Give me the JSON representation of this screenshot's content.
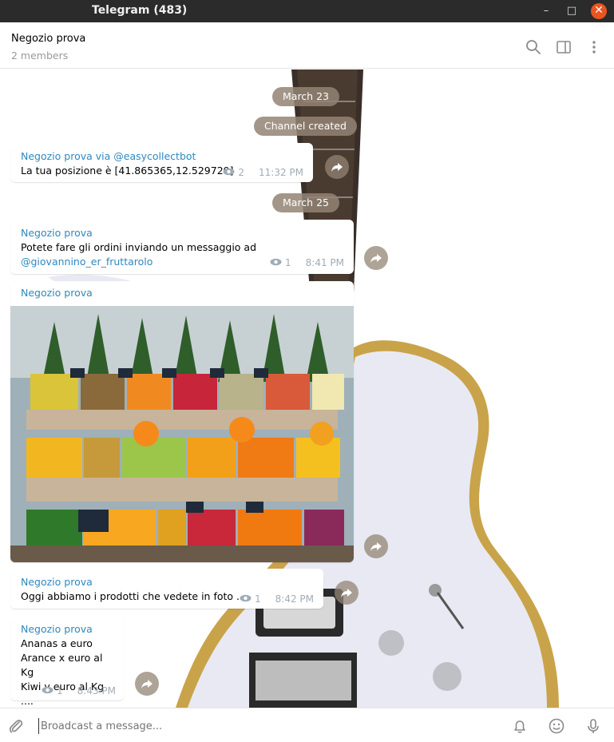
{
  "window": {
    "title": "Telegram (483)",
    "minimize": "–",
    "maximize": "□",
    "close": "✕"
  },
  "header": {
    "chat_name": "Negozio prova",
    "subtitle": "2 members"
  },
  "services": {
    "date1": "March 23",
    "created": "Channel created",
    "date2": "March 25"
  },
  "messages": [
    {
      "author": "Negozio prova via @easycollectbot",
      "text": "La tua posizione è [41.865365,12.529729]",
      "views": "2",
      "time": "11:32 PM"
    },
    {
      "author": "Negozio prova",
      "text": "Potete fare gli ordini inviando un messaggio ad",
      "link": "@giovannino_er_fruttarolo",
      "views": "1",
      "time": "8:41 PM"
    },
    {
      "author": "Negozio prova",
      "photo_alt": "fruit-stand-photo"
    },
    {
      "author": "Negozio prova",
      "text": "Oggi abbiamo i prodotti che vedete in foto ...",
      "views": "1",
      "time": "8:42 PM"
    },
    {
      "author": "Negozio prova",
      "text": "Ananas a euro\nArance x euro al Kg\nKiwi y euro al Kg\n....",
      "views": "1",
      "time": "8:43 PM"
    }
  ],
  "composer": {
    "placeholder": "Broadcast a message..."
  },
  "colors": {
    "accent": "#2e89c0",
    "service_bg": "#938474",
    "close_button": "#e95420"
  }
}
